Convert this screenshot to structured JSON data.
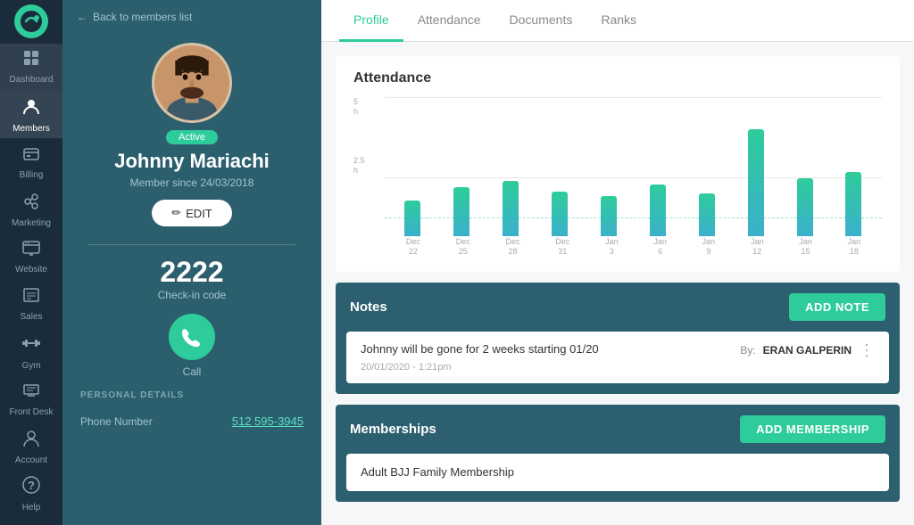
{
  "sidebar": {
    "logo": "C",
    "items": [
      {
        "id": "dashboard",
        "label": "Dashboard",
        "icon": "⊞",
        "active": false
      },
      {
        "id": "members",
        "label": "Members",
        "icon": "👤",
        "active": true
      },
      {
        "id": "billing",
        "label": "Billing",
        "icon": "💵",
        "active": false
      },
      {
        "id": "marketing",
        "label": "Marketing",
        "icon": "👥",
        "active": false
      },
      {
        "id": "website",
        "label": "Website",
        "icon": "🖥",
        "active": false
      },
      {
        "id": "sales",
        "label": "Sales",
        "icon": "📋",
        "active": false
      },
      {
        "id": "gym",
        "label": "Gym",
        "icon": "🏋",
        "active": false
      },
      {
        "id": "frontdesk",
        "label": "Front Desk",
        "icon": "🖨",
        "active": false
      },
      {
        "id": "account",
        "label": "Account",
        "icon": "👤",
        "active": false
      },
      {
        "id": "help",
        "label": "Help",
        "icon": "❓",
        "active": false
      }
    ]
  },
  "profile": {
    "back_label": "Back to members list",
    "status": "Active",
    "name": "Johnny Mariachi",
    "member_since": "Member since 24/03/2018",
    "edit_label": "EDIT",
    "checkin_code": "2222",
    "checkin_label": "Check-in code",
    "call_label": "Call",
    "personal_details_heading": "PERSONAL DETAILS",
    "phone_label": "Phone Number",
    "phone_value": "512 595-3945"
  },
  "tabs": [
    {
      "id": "profile",
      "label": "Profile",
      "active": true
    },
    {
      "id": "attendance",
      "label": "Attendance",
      "active": false
    },
    {
      "id": "documents",
      "label": "Documents",
      "active": false
    },
    {
      "id": "ranks",
      "label": "Ranks",
      "active": false
    }
  ],
  "attendance_chart": {
    "title": "Attendance",
    "y_labels": [
      {
        "val": "5\nh"
      },
      {
        "val": "2.5\nh"
      }
    ],
    "x_labels": [
      {
        "line1": "Dec",
        "line2": "22"
      },
      {
        "line1": "Dec",
        "line2": "25"
      },
      {
        "line1": "Dec",
        "line2": "28"
      },
      {
        "line1": "Dec",
        "line2": "31"
      },
      {
        "line1": "Jan",
        "line2": "3"
      },
      {
        "line1": "Jan",
        "line2": "6"
      },
      {
        "line1": "Jan",
        "line2": "9"
      },
      {
        "line1": "Jan",
        "line2": "12"
      },
      {
        "line1": "Jan",
        "line2": "15"
      },
      {
        "line1": "Jan",
        "line2": "18"
      }
    ],
    "bars": [
      40,
      55,
      62,
      50,
      45,
      58,
      48,
      120,
      65,
      72
    ]
  },
  "notes": {
    "title": "Notes",
    "add_btn": "ADD NOTE",
    "items": [
      {
        "text": "Johnny will be gone for 2 weeks starting 01/20",
        "by_label": "By:",
        "author": "ERAN GALPERIN",
        "date": "20/01/2020 - 1:21pm"
      }
    ]
  },
  "memberships": {
    "title": "Memberships",
    "add_btn": "ADD MEMBERSHIP",
    "items": [
      {
        "name": "Adult BJJ Family Membership"
      }
    ]
  }
}
